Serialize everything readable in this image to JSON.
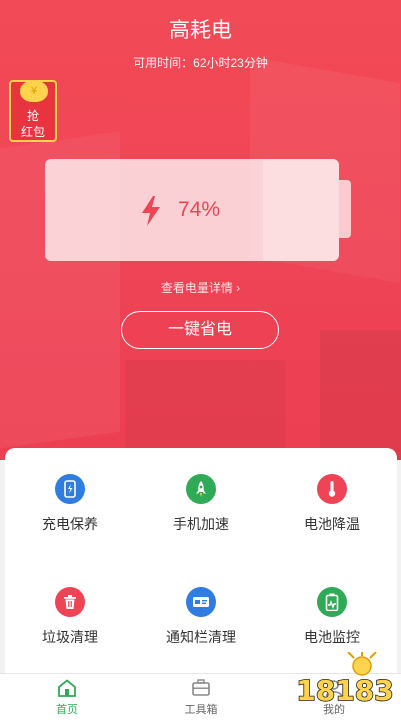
{
  "header": {
    "title": "高耗电",
    "time_label": "可用时间：",
    "time_value": "62小时23分钟"
  },
  "promo": {
    "line1": "抢",
    "line2": "红包",
    "coin": "¥"
  },
  "battery": {
    "level": 0.74,
    "percent_text": "74%",
    "detail_link": "查看电量详情 ›",
    "save_button": "一键省电"
  },
  "tools": [
    {
      "label": "充电保养",
      "icon": "charge-care-icon",
      "color": "#2f7de1"
    },
    {
      "label": "手机加速",
      "icon": "rocket-icon",
      "color": "#2faa56"
    },
    {
      "label": "电池降温",
      "icon": "thermometer-icon",
      "color": "#ef4455"
    },
    {
      "label": "垃圾清理",
      "icon": "trash-icon",
      "color": "#ef4455"
    },
    {
      "label": "通知栏清理",
      "icon": "notification-card-icon",
      "color": "#2f7de1"
    },
    {
      "label": "电池监控",
      "icon": "battery-monitor-icon",
      "color": "#2faa56"
    }
  ],
  "tabbar": {
    "tabs": [
      {
        "label": "首页",
        "icon": "home-icon",
        "active": true
      },
      {
        "label": "工具箱",
        "icon": "toolbox-icon",
        "active": false
      },
      {
        "label": "我的",
        "icon": "profile-icon",
        "active": false
      }
    ]
  },
  "colors": {
    "accent_red": "#ef4455",
    "active_green": "#2faa56"
  },
  "watermark": {
    "text": "18183"
  }
}
